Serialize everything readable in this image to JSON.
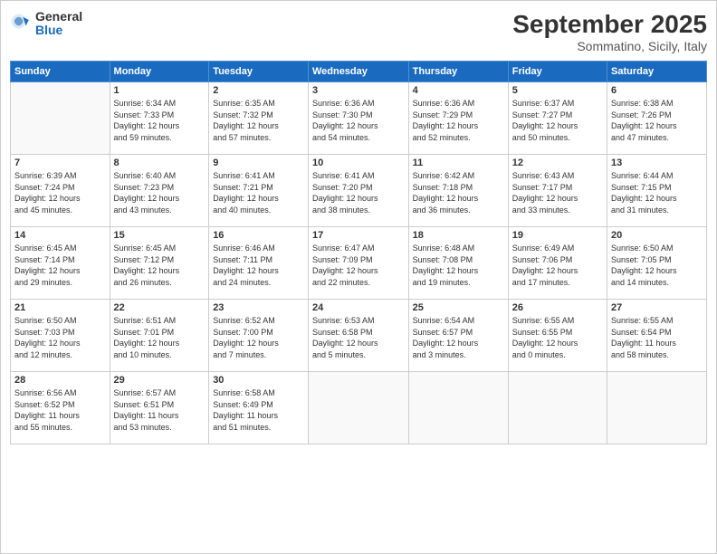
{
  "header": {
    "logo_general": "General",
    "logo_blue": "Blue",
    "month_title": "September 2025",
    "location": "Sommatino, Sicily, Italy"
  },
  "days_of_week": [
    "Sunday",
    "Monday",
    "Tuesday",
    "Wednesday",
    "Thursday",
    "Friday",
    "Saturday"
  ],
  "weeks": [
    [
      {
        "num": "",
        "info": ""
      },
      {
        "num": "1",
        "info": "Sunrise: 6:34 AM\nSunset: 7:33 PM\nDaylight: 12 hours\nand 59 minutes."
      },
      {
        "num": "2",
        "info": "Sunrise: 6:35 AM\nSunset: 7:32 PM\nDaylight: 12 hours\nand 57 minutes."
      },
      {
        "num": "3",
        "info": "Sunrise: 6:36 AM\nSunset: 7:30 PM\nDaylight: 12 hours\nand 54 minutes."
      },
      {
        "num": "4",
        "info": "Sunrise: 6:36 AM\nSunset: 7:29 PM\nDaylight: 12 hours\nand 52 minutes."
      },
      {
        "num": "5",
        "info": "Sunrise: 6:37 AM\nSunset: 7:27 PM\nDaylight: 12 hours\nand 50 minutes."
      },
      {
        "num": "6",
        "info": "Sunrise: 6:38 AM\nSunset: 7:26 PM\nDaylight: 12 hours\nand 47 minutes."
      }
    ],
    [
      {
        "num": "7",
        "info": "Sunrise: 6:39 AM\nSunset: 7:24 PM\nDaylight: 12 hours\nand 45 minutes."
      },
      {
        "num": "8",
        "info": "Sunrise: 6:40 AM\nSunset: 7:23 PM\nDaylight: 12 hours\nand 43 minutes."
      },
      {
        "num": "9",
        "info": "Sunrise: 6:41 AM\nSunset: 7:21 PM\nDaylight: 12 hours\nand 40 minutes."
      },
      {
        "num": "10",
        "info": "Sunrise: 6:41 AM\nSunset: 7:20 PM\nDaylight: 12 hours\nand 38 minutes."
      },
      {
        "num": "11",
        "info": "Sunrise: 6:42 AM\nSunset: 7:18 PM\nDaylight: 12 hours\nand 36 minutes."
      },
      {
        "num": "12",
        "info": "Sunrise: 6:43 AM\nSunset: 7:17 PM\nDaylight: 12 hours\nand 33 minutes."
      },
      {
        "num": "13",
        "info": "Sunrise: 6:44 AM\nSunset: 7:15 PM\nDaylight: 12 hours\nand 31 minutes."
      }
    ],
    [
      {
        "num": "14",
        "info": "Sunrise: 6:45 AM\nSunset: 7:14 PM\nDaylight: 12 hours\nand 29 minutes."
      },
      {
        "num": "15",
        "info": "Sunrise: 6:45 AM\nSunset: 7:12 PM\nDaylight: 12 hours\nand 26 minutes."
      },
      {
        "num": "16",
        "info": "Sunrise: 6:46 AM\nSunset: 7:11 PM\nDaylight: 12 hours\nand 24 minutes."
      },
      {
        "num": "17",
        "info": "Sunrise: 6:47 AM\nSunset: 7:09 PM\nDaylight: 12 hours\nand 22 minutes."
      },
      {
        "num": "18",
        "info": "Sunrise: 6:48 AM\nSunset: 7:08 PM\nDaylight: 12 hours\nand 19 minutes."
      },
      {
        "num": "19",
        "info": "Sunrise: 6:49 AM\nSunset: 7:06 PM\nDaylight: 12 hours\nand 17 minutes."
      },
      {
        "num": "20",
        "info": "Sunrise: 6:50 AM\nSunset: 7:05 PM\nDaylight: 12 hours\nand 14 minutes."
      }
    ],
    [
      {
        "num": "21",
        "info": "Sunrise: 6:50 AM\nSunset: 7:03 PM\nDaylight: 12 hours\nand 12 minutes."
      },
      {
        "num": "22",
        "info": "Sunrise: 6:51 AM\nSunset: 7:01 PM\nDaylight: 12 hours\nand 10 minutes."
      },
      {
        "num": "23",
        "info": "Sunrise: 6:52 AM\nSunset: 7:00 PM\nDaylight: 12 hours\nand 7 minutes."
      },
      {
        "num": "24",
        "info": "Sunrise: 6:53 AM\nSunset: 6:58 PM\nDaylight: 12 hours\nand 5 minutes."
      },
      {
        "num": "25",
        "info": "Sunrise: 6:54 AM\nSunset: 6:57 PM\nDaylight: 12 hours\nand 3 minutes."
      },
      {
        "num": "26",
        "info": "Sunrise: 6:55 AM\nSunset: 6:55 PM\nDaylight: 12 hours\nand 0 minutes."
      },
      {
        "num": "27",
        "info": "Sunrise: 6:55 AM\nSunset: 6:54 PM\nDaylight: 11 hours\nand 58 minutes."
      }
    ],
    [
      {
        "num": "28",
        "info": "Sunrise: 6:56 AM\nSunset: 6:52 PM\nDaylight: 11 hours\nand 55 minutes."
      },
      {
        "num": "29",
        "info": "Sunrise: 6:57 AM\nSunset: 6:51 PM\nDaylight: 11 hours\nand 53 minutes."
      },
      {
        "num": "30",
        "info": "Sunrise: 6:58 AM\nSunset: 6:49 PM\nDaylight: 11 hours\nand 51 minutes."
      },
      {
        "num": "",
        "info": ""
      },
      {
        "num": "",
        "info": ""
      },
      {
        "num": "",
        "info": ""
      },
      {
        "num": "",
        "info": ""
      }
    ]
  ]
}
